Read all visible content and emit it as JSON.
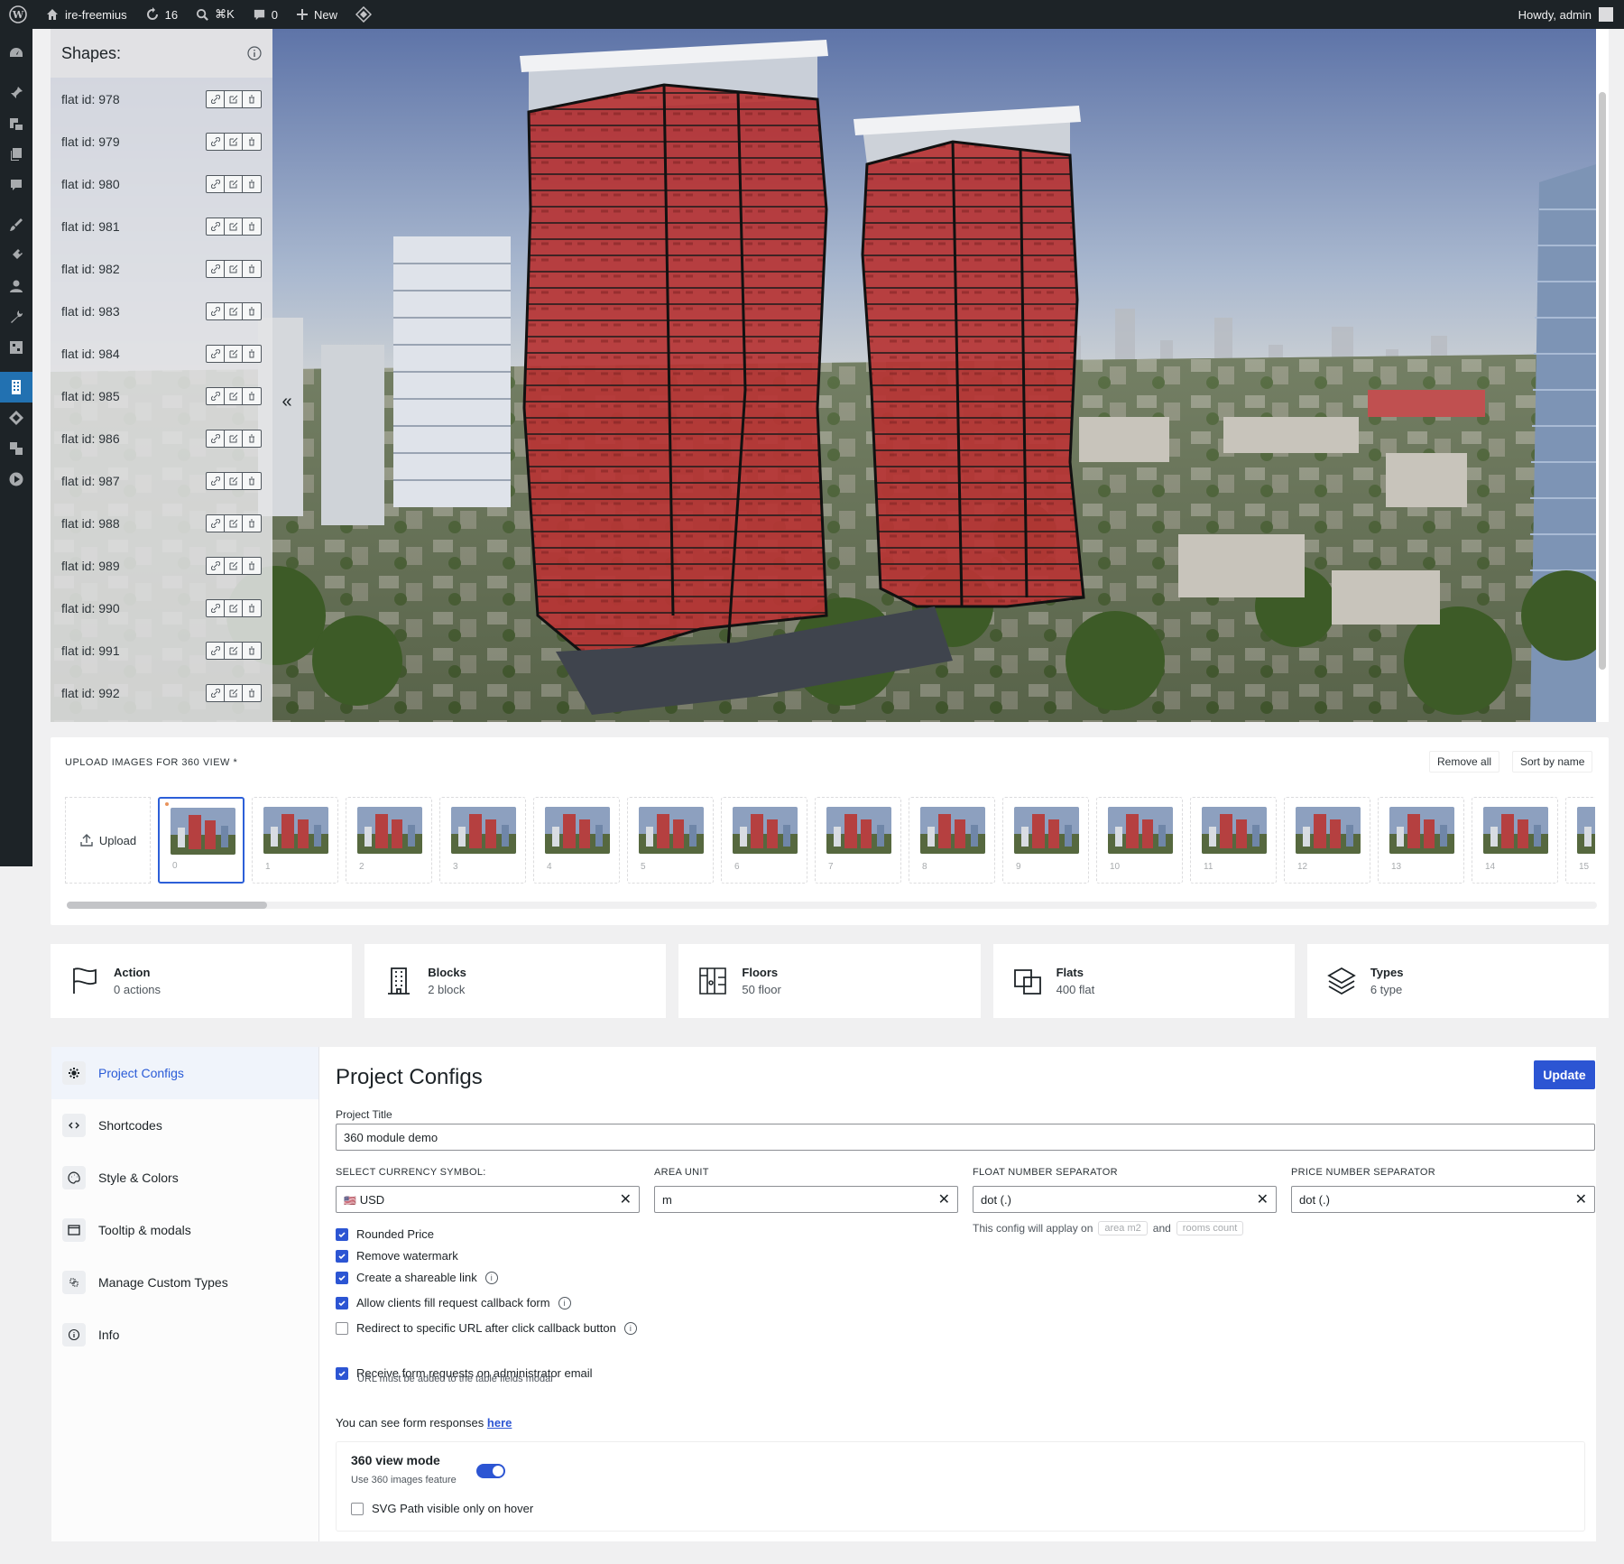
{
  "adminbar": {
    "site_name": "ire-freemius",
    "updates_count": "16",
    "search_shortcut": "⌘K",
    "comments_count": "0",
    "new_label": "New",
    "howdy": "Howdy, admin"
  },
  "shapes": {
    "title": "Shapes:",
    "items": [
      {
        "label": "flat id: 978"
      },
      {
        "label": "flat id: 979"
      },
      {
        "label": "flat id: 980"
      },
      {
        "label": "flat id: 981"
      },
      {
        "label": "flat id: 982"
      },
      {
        "label": "flat id: 983"
      },
      {
        "label": "flat id: 984"
      },
      {
        "label": "flat id: 985"
      },
      {
        "label": "flat id: 986"
      },
      {
        "label": "flat id: 987"
      },
      {
        "label": "flat id: 988"
      },
      {
        "label": "flat id: 989"
      },
      {
        "label": "flat id: 990"
      },
      {
        "label": "flat id: 991"
      },
      {
        "label": "flat id: 992"
      }
    ],
    "collapse_glyph": "«"
  },
  "upload": {
    "label": "UPLOAD IMAGES FOR 360 VIEW *",
    "remove_all": "Remove all",
    "sort_by_name": "Sort by name",
    "upload_label": "Upload",
    "thumbnails": [
      "0",
      "1",
      "2",
      "3",
      "4",
      "5",
      "6",
      "7",
      "8",
      "9",
      "10",
      "11",
      "12",
      "13",
      "14",
      "15"
    ],
    "selected_index": 0
  },
  "stats": [
    {
      "title": "Action",
      "value": "0 actions",
      "icon": "flag-icon"
    },
    {
      "title": "Blocks",
      "value": "2 block",
      "icon": "building-icon"
    },
    {
      "title": "Floors",
      "value": "50 floor",
      "icon": "floors-icon"
    },
    {
      "title": "Flats",
      "value": "400 flat",
      "icon": "flats-icon"
    },
    {
      "title": "Types",
      "value": "6 type",
      "icon": "layers-icon"
    }
  ],
  "config_nav": [
    {
      "label": "Project Configs",
      "icon": "gear-icon"
    },
    {
      "label": "Shortcodes",
      "icon": "code-icon"
    },
    {
      "label": "Style & Colors",
      "icon": "palette-icon"
    },
    {
      "label": "Tooltip & modals",
      "icon": "window-icon"
    },
    {
      "label": "Manage Custom Types",
      "icon": "custom-types-icon"
    },
    {
      "label": "Info",
      "icon": "info-icon"
    }
  ],
  "config": {
    "heading": "Project Configs",
    "update_label": "Update",
    "title_label": "Project Title",
    "title_value": "360 module demo",
    "currency_label": "SELECT CURRENCY SYMBOL:",
    "currency_flag": "🇺🇸",
    "currency_value": "USD",
    "area_label": "AREA UNIT",
    "area_value": "m",
    "float_label": "FLOAT NUMBER SEPARATOR",
    "float_value": "dot (.)",
    "price_label": "PRICE NUMBER SEPARATOR",
    "price_value": "dot (.)",
    "float_hint_prefix": "This config will applay on",
    "float_hint_chip1": "area m2",
    "float_hint_and": "and",
    "float_hint_chip2": "rooms count",
    "checks": [
      {
        "label": "Rounded Price",
        "checked": true
      },
      {
        "label": "Remove watermark",
        "checked": true
      },
      {
        "label": "Create a shareable link",
        "checked": true
      },
      {
        "label": "Allow clients fill request callback form",
        "checked": true
      },
      {
        "label": "Redirect to specific URL after click callback button",
        "checked": false
      },
      {
        "label": "Receive form requests on administrator email",
        "checked": true
      }
    ],
    "redirect_hint": "URL must be added to the table fields modal",
    "responses_text": "You can see form responses",
    "responses_link": "here",
    "view_mode_title": "360 view mode",
    "view_mode_sub": "Use 360 images feature",
    "view_mode_on": true,
    "svg_hover_label": "SVG Path visible only on hover",
    "svg_hover_checked": false
  },
  "colors": {
    "accent": "#2c55d3",
    "overlay_red": "#b52a2a",
    "admin_bar": "#1d2327"
  }
}
